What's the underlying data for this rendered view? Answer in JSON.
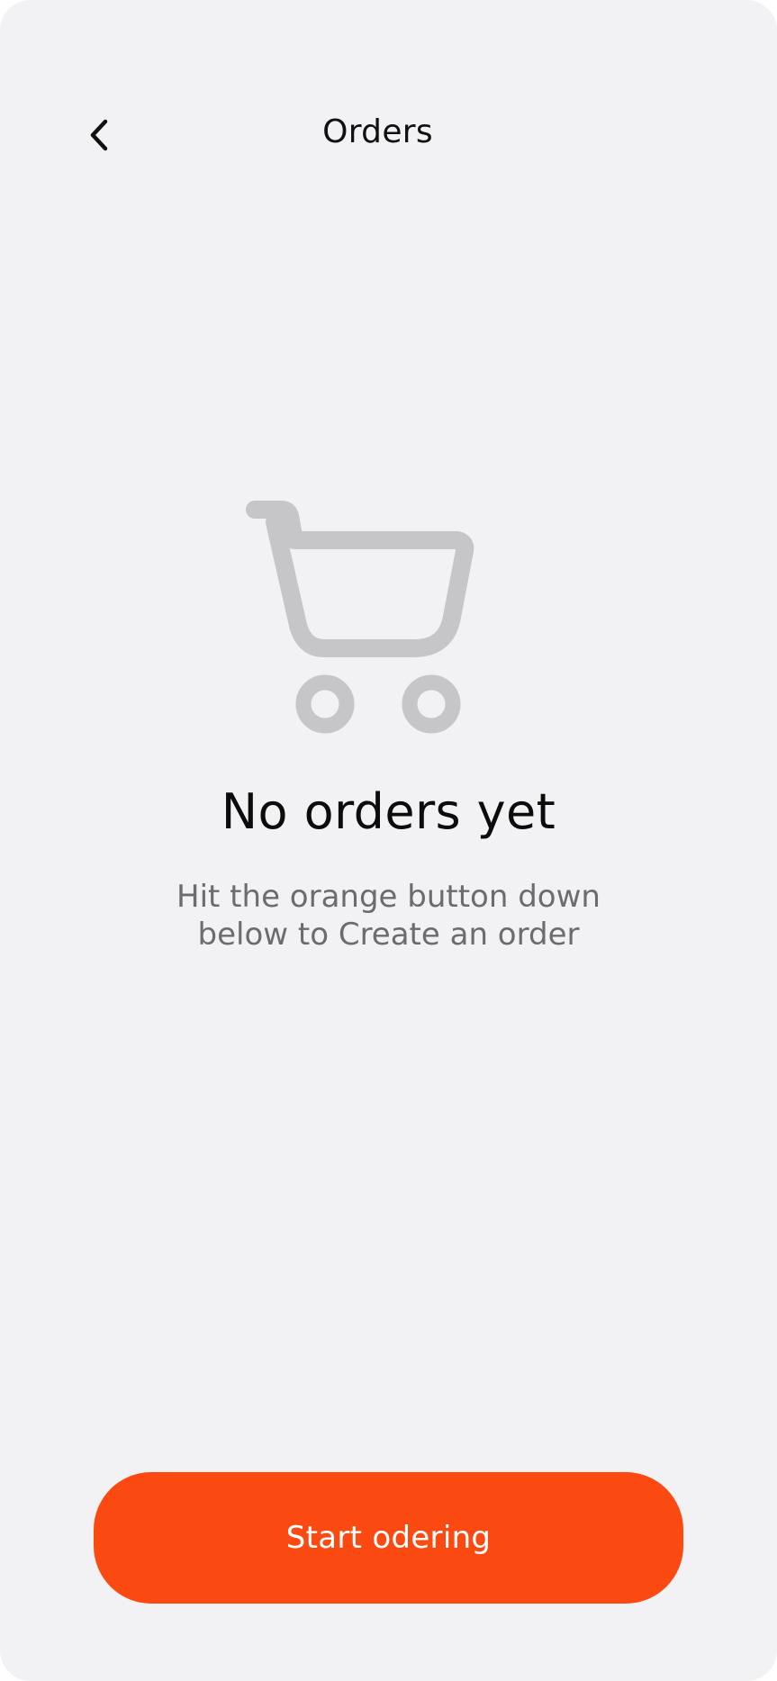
{
  "header": {
    "title": "Orders",
    "back_icon": "chevron-left-icon"
  },
  "empty_state": {
    "icon": "shopping-cart-icon",
    "title": "No orders yet",
    "subtitle": "Hit the orange button down\nbelow to Create an order"
  },
  "cta": {
    "label": "Start odering"
  },
  "colors": {
    "background": "#f2f2f4",
    "accent": "#fa4a12",
    "illustration": "#c6c6c8",
    "subtitle": "#6b6b70"
  }
}
